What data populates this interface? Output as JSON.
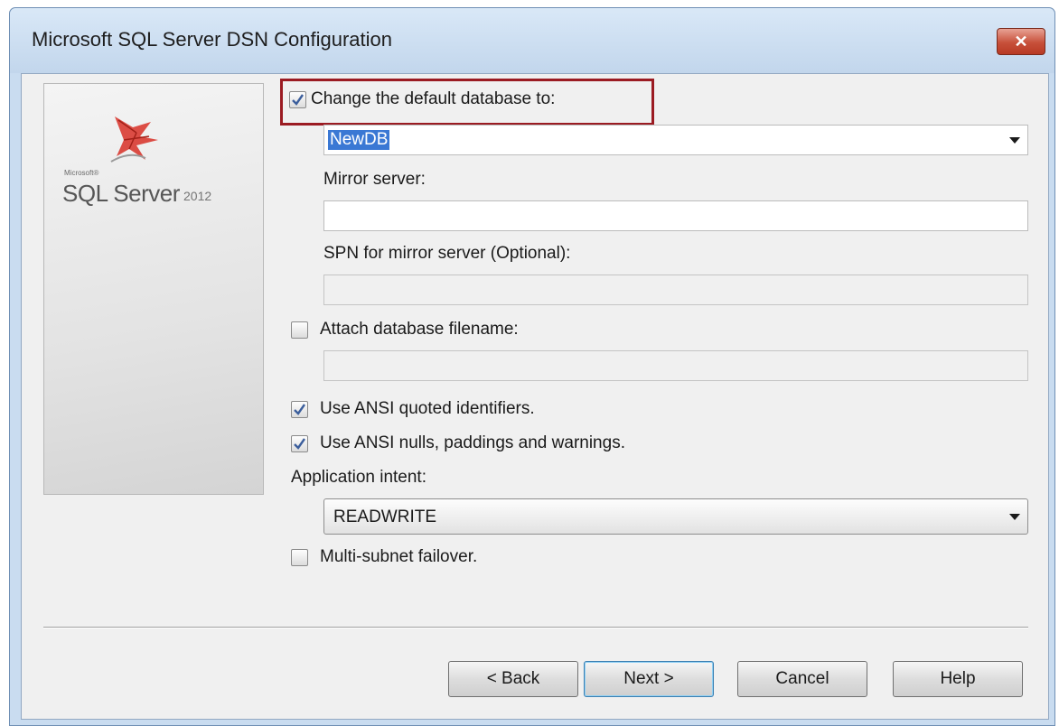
{
  "window": {
    "title": "Microsoft SQL Server DSN Configuration",
    "close_glyph": "✕"
  },
  "branding": {
    "microsoft": "Microsoft®",
    "product": "SQL Server",
    "version": "2012",
    "icon": "sql-server-logo-icon"
  },
  "default_database": {
    "checked": true,
    "label": "Change the default database to:",
    "value": "NewDB"
  },
  "mirror_server": {
    "label": "Mirror server:",
    "value": ""
  },
  "spn_mirror": {
    "label": "SPN for mirror server (Optional):",
    "value": ""
  },
  "attach_db": {
    "checked": false,
    "label": "Attach database filename:",
    "value": ""
  },
  "ansi_quoted": {
    "checked": true,
    "label": "Use ANSI quoted identifiers."
  },
  "ansi_nulls": {
    "checked": true,
    "label": "Use ANSI nulls, paddings and warnings."
  },
  "app_intent": {
    "label": "Application intent:",
    "value": "READWRITE"
  },
  "multi_subnet": {
    "checked": false,
    "label": "Multi-subnet failover."
  },
  "buttons": {
    "back": "< Back",
    "next": "Next >",
    "cancel": "Cancel",
    "help": "Help"
  },
  "colors": {
    "highlight": "#9b1b22",
    "selection": "#3a78d4"
  }
}
